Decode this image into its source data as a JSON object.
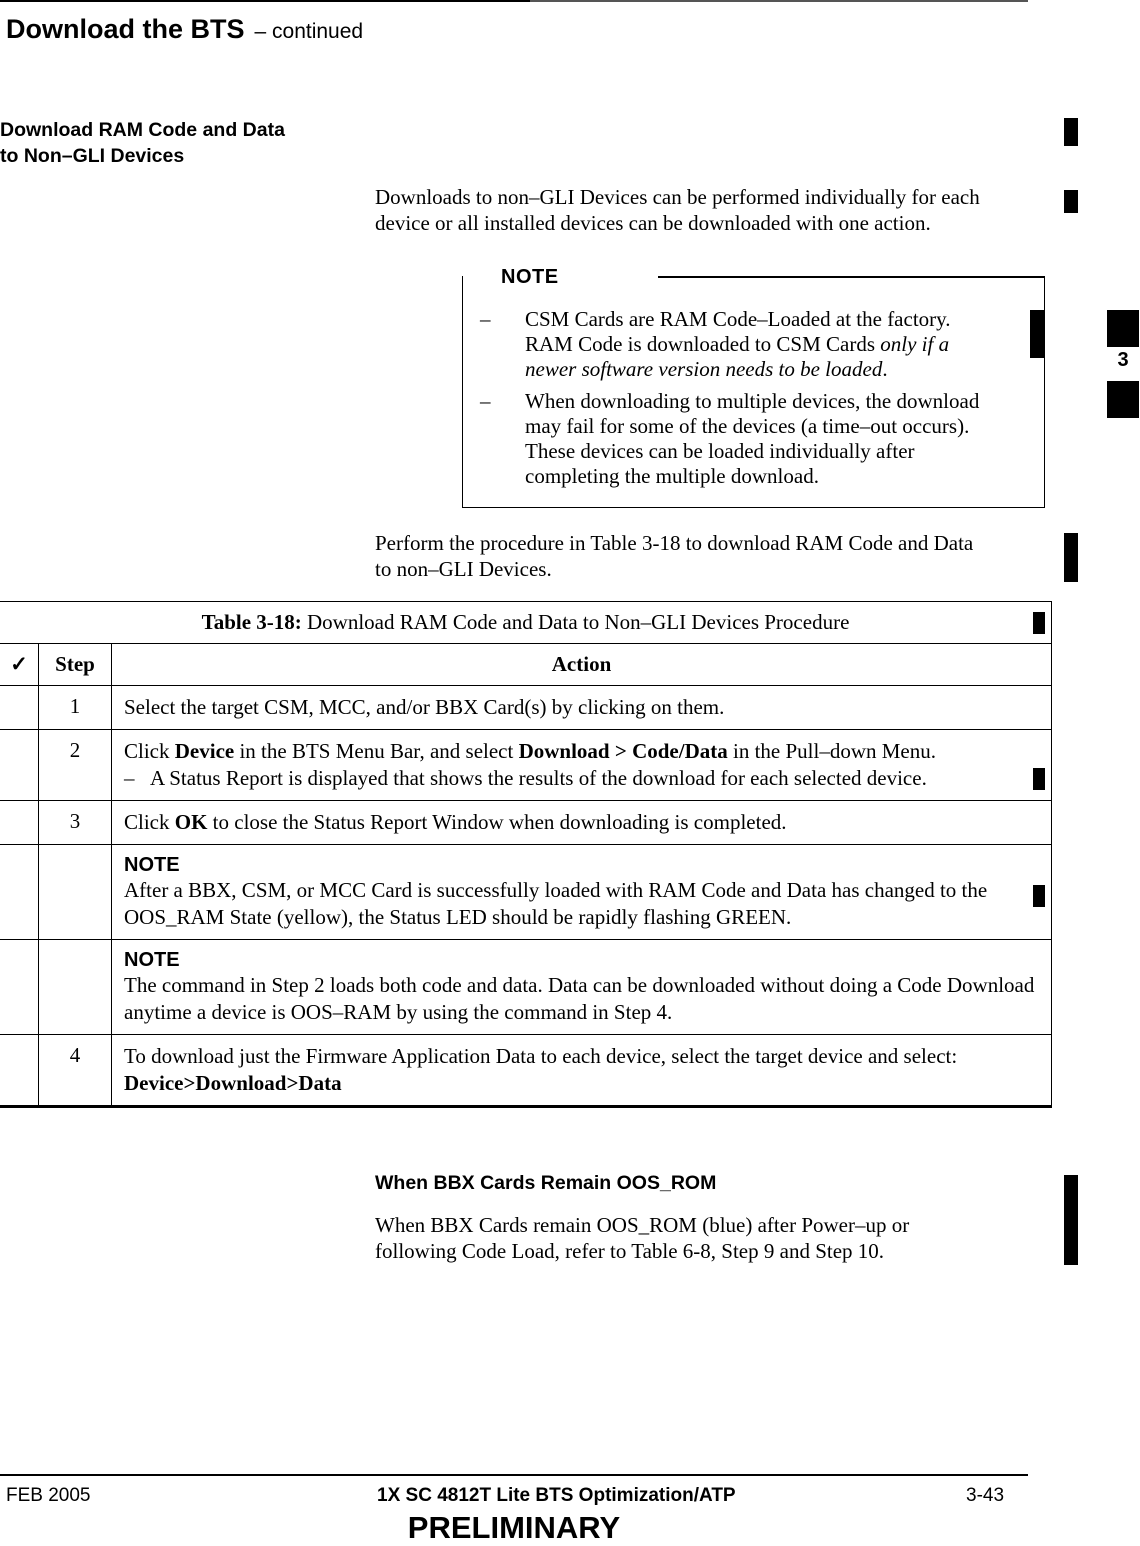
{
  "header": {
    "title": "Download the BTS",
    "continued": "– continued"
  },
  "section": {
    "heading_line1": "Download RAM Code and Data",
    "heading_line2": "to Non–GLI Devices",
    "intro_line1": "Downloads to non–GLI Devices can be performed individually for each",
    "intro_line2": "device or all installed devices can be downloaded with one action.",
    "note": {
      "label": "NOTE",
      "items": [
        {
          "dash": "–",
          "line1": "CSM Cards are RAM Code–Loaded at the factory.",
          "line2_normal": "RAM Code is downloaded to CSM Cards ",
          "line2_italic": "only if a",
          "line3_italic": "newer software version needs to be loaded",
          "line3_end": "."
        },
        {
          "dash": "–",
          "line1": "When downloading to multiple devices, the download",
          "line2": "may fail for some of the devices (a time–out occurs).",
          "line3": "These devices can be loaded individually after",
          "line4": "completing the multiple download."
        }
      ]
    },
    "perform_line1": "Perform the procedure in Table 3-18 to download RAM Code and Data",
    "perform_line2": "to non–GLI Devices."
  },
  "table": {
    "caption_bold": "Table 3-18:",
    "caption_text": " Download RAM Code and Data to Non–GLI Devices Procedure",
    "headers": {
      "check": "✓",
      "step": "Step",
      "action": "Action"
    },
    "rows": [
      {
        "step": "1",
        "text": "Select the target CSM, MCC, and/or BBX Card(s) by clicking on them."
      },
      {
        "step": "2",
        "p1": "Click ",
        "b1": "Device",
        "p2": " in the BTS Menu Bar, and select ",
        "b2": "Download > Code/Data",
        "p3": " in the Pull–down Menu.",
        "sub_dash": "–",
        "sub_text": "A Status Report is displayed that shows the results of the download for each selected device."
      },
      {
        "step": "3",
        "p1": "Click ",
        "b1": "OK",
        "p2": " to close the Status Report Window when downloading is completed."
      },
      {
        "step": "",
        "note_label": "NOTE",
        "text": "After a BBX, CSM, or MCC Card is successfully loaded with RAM Code and Data has changed to the OOS_RAM State (yellow), the Status LED should be rapidly flashing GREEN."
      },
      {
        "step": "",
        "note_label": "NOTE",
        "text": "The command in Step 2 loads both code and data. Data can be downloaded without doing a Code Download anytime a device is OOS–RAM by using the command in Step 4."
      },
      {
        "step": "4",
        "p1": "To download just the Firmware Application Data to each device, select the target device and select: ",
        "b1": "Device>Download>Data"
      }
    ]
  },
  "bbx_section": {
    "heading": "When BBX Cards Remain OOS_ROM",
    "line1": "When BBX Cards remain OOS_ROM (blue) after Power–up or",
    "line2": "following Code Load, refer to Table 6-8, Step 9 and Step 10."
  },
  "chapter_tab": {
    "number": "3"
  },
  "footer": {
    "date": "FEB 2005",
    "doc_title": "1X SC 4812T Lite BTS Optimization/ATP",
    "page": "3-43",
    "status": "PRELIMINARY"
  }
}
